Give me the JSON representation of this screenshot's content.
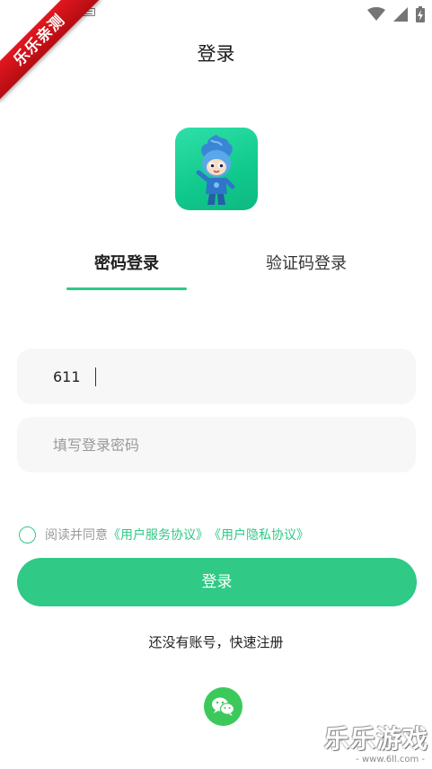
{
  "header": {
    "title": "登录"
  },
  "watermark_ribbon": {
    "text": "乐乐亲测"
  },
  "tabs": [
    {
      "label": "密码登录",
      "active": true
    },
    {
      "label": "验证码登录",
      "active": false
    }
  ],
  "form": {
    "account_value": "611",
    "password_placeholder": "填写登录密码"
  },
  "agreement": {
    "prefix": "阅读并同意",
    "service_link": "《用户服务协议》",
    "privacy_link": "《用户隐私协议》",
    "checked": false
  },
  "login_button": "登录",
  "register_link": "还没有账号，快速注册",
  "watermark": {
    "title": "乐乐游戏",
    "url": "- www.6ll.com -"
  },
  "colors": {
    "accent": "#30c986",
    "input_bg": "#f7f7f7",
    "wechat": "#3cc95c"
  },
  "icons": [
    "back-arrow-icon",
    "wifi-icon",
    "signal-icon",
    "battery-charging-icon",
    "keyboard-icon",
    "wechat-icon",
    "app-logo-mascot"
  ]
}
